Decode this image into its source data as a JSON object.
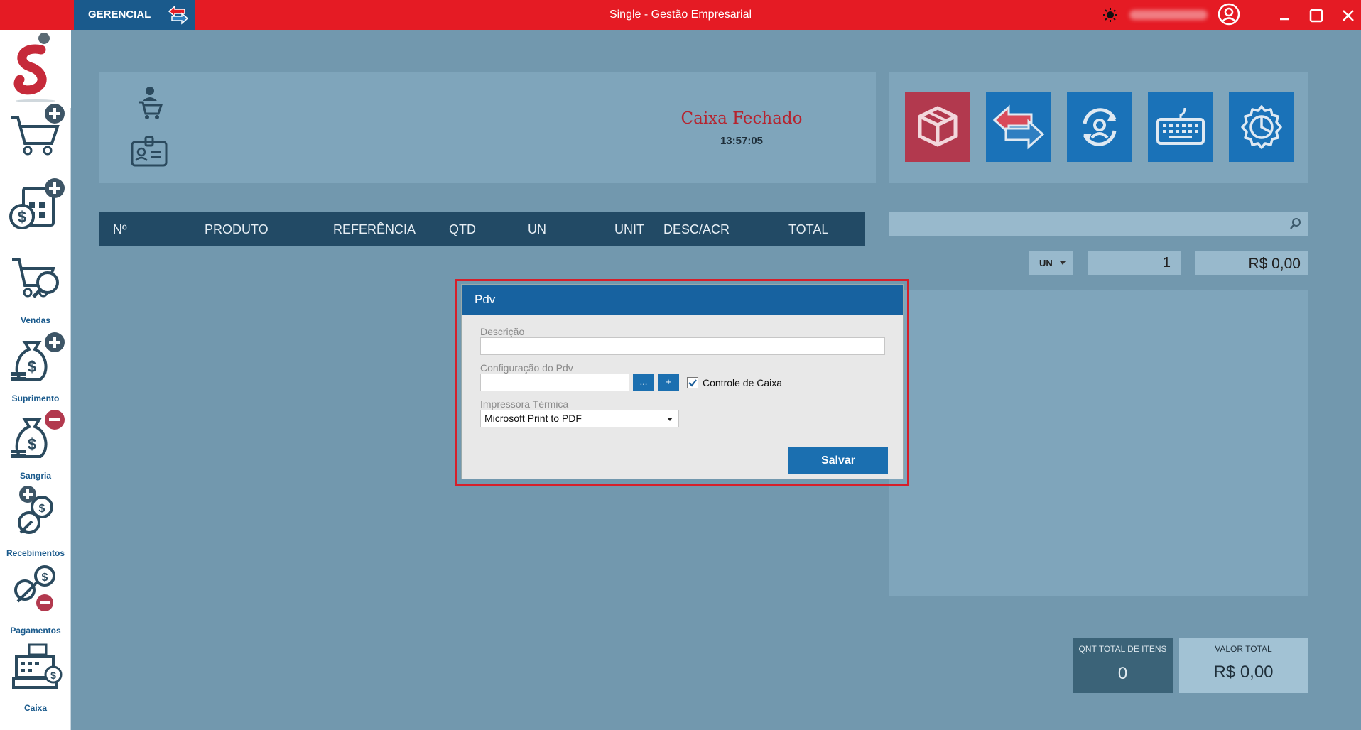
{
  "titlebar": {
    "module_label": "GERENCIAL",
    "app_title": "Single - Gestão Empresarial",
    "swap_icon": "swap-arrows-icon",
    "theme_icon": "sun-icon",
    "user_icon": "user-circle-icon",
    "minimize_icon": "minimize-icon",
    "maximize_icon": "maximize-icon",
    "close_icon": "close-icon"
  },
  "sidebar": {
    "logo_icon": "single-logo-icon",
    "items": [
      {
        "label": "",
        "icon": "cart-add-icon"
      },
      {
        "label": "",
        "icon": "calculator-add-icon"
      },
      {
        "label": "Vendas",
        "icon": "cart-search-icon"
      },
      {
        "label": "Suprimento",
        "icon": "money-bag-add-icon"
      },
      {
        "label": "Sangria",
        "icon": "money-bag-remove-icon"
      },
      {
        "label": "Recebimentos",
        "icon": "coins-add-icon"
      },
      {
        "label": "Pagamentos",
        "icon": "coins-remove-icon"
      },
      {
        "label": "Caixa",
        "icon": "cash-register-icon"
      }
    ]
  },
  "info": {
    "status": "Caixa Fechado",
    "time": "13:57:05",
    "cashier_icon": "cashier-icon",
    "id_card_icon": "id-card-icon"
  },
  "actions": [
    {
      "icon": "box-icon",
      "color": "#b2394e"
    },
    {
      "icon": "transfer-arrows-icon",
      "color": "#1a72b8"
    },
    {
      "icon": "user-sync-icon",
      "color": "#1a72b8"
    },
    {
      "icon": "keyboard-icon",
      "color": "#1a72b8"
    },
    {
      "icon": "settings-chart-icon",
      "color": "#1a72b8"
    }
  ],
  "table": {
    "columns": [
      "Nº",
      "PRODUTO",
      "REFERÊNCIA",
      "QTD",
      "UN",
      "UNIT",
      "DESC/ACR",
      "TOTAL"
    ]
  },
  "entry": {
    "search_value": "",
    "unit": "UN",
    "quantity": "1",
    "price": "R$ 0,00"
  },
  "totals": {
    "qty_label": "QNT TOTAL DE ITENS",
    "qty_value": "0",
    "value_label": "VALOR TOTAL",
    "value_value": "R$ 0,00"
  },
  "dialog": {
    "title": "Pdv",
    "descricao_label": "Descrição",
    "descricao_value": "",
    "config_label": "Configuração do Pdv",
    "config_value": "",
    "more_btn": "...",
    "add_btn": "+",
    "controle_label": "Controle de Caixa",
    "controle_checked": true,
    "impressora_label": "Impressora Térmica",
    "impressora_value": "Microsoft Print to PDF",
    "save_btn": "Salvar"
  },
  "colors": {
    "titlebar": "#e51b24",
    "accent": "#1b6fb0",
    "background": "#7298ae"
  }
}
